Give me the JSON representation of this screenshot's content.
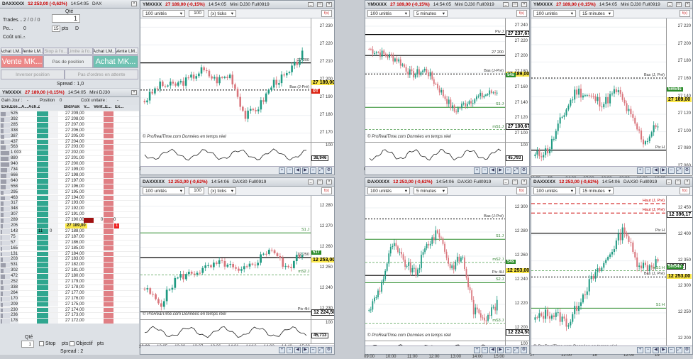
{
  "top_panel": {
    "title": {
      "ticker": "DAXXXXX",
      "price": "12 253,00 (-0,62%)",
      "time": "14:54:05",
      "name": "DAX"
    },
    "qty_label": "Qté",
    "qty_value": "1",
    "trades_label": "Trades...",
    "trades_value": "2 / 0 / 0",
    "po_label": "Po...",
    "po_value": "0",
    "d_label": "D",
    "pts_value": "15",
    "pts_label": "pts",
    "cout_label": "Coût uni...",
    "cout_value": "-",
    "buttons": [
      "Achat LM...",
      "Vente LM...",
      "Stop à l'o...",
      "Limite à l'o...",
      "Achat LM...",
      "Vente LM..."
    ],
    "vente_mkt": "Vente MK...",
    "achat_mkt": "Achat MK...",
    "pas_de_position": "Pas de position",
    "inverser": "Inverser position",
    "pas_ordres": "Pas d'ordres en attente",
    "spread": "Spread : 1,0"
  },
  "ladder_panel": {
    "title": {
      "ticker": "YMXXXX",
      "price": "27 189,00 (-0,15%)",
      "time": "14:54:05",
      "name": "Mini DJ30"
    },
    "gain_label": "Gain Jour :",
    "gain_value": "-",
    "position_label": "Position",
    "position_value": "0",
    "cout_label": "Coût unitaire :",
    "cout_value": "-",
    "headers": [
      "Exé...",
      "Exé...",
      "A...",
      "Ach...",
      "/",
      "Bid/Ask",
      "V...",
      "Vent...",
      "E...",
      "Ex..."
    ],
    "rows": [
      {
        "v": "525",
        "p": "27 209,00"
      },
      {
        "v": "392",
        "p": "27 208,00"
      },
      {
        "v": "285",
        "p": "27 207,00"
      },
      {
        "v": "338",
        "p": "27 206,00"
      },
      {
        "v": "387",
        "p": "27 205,00"
      },
      {
        "v": "437",
        "p": "27 204,00"
      },
      {
        "v": "563",
        "p": "27 203,00"
      },
      {
        "v": "1 003",
        "p": "27 202,00"
      },
      {
        "v": "880",
        "p": "27 201,00"
      },
      {
        "v": "940",
        "p": "27 200,00"
      },
      {
        "v": "734",
        "p": "27 199,00"
      },
      {
        "v": "666",
        "p": "27 198,00"
      },
      {
        "v": "640",
        "p": "27 197,00"
      },
      {
        "v": "558",
        "p": "27 196,00"
      },
      {
        "v": "295",
        "p": "27 195,00"
      },
      {
        "v": "463",
        "p": "27 194,00"
      },
      {
        "v": "317",
        "p": "27 193,00"
      },
      {
        "v": "348",
        "p": "27 192,00"
      },
      {
        "v": "307",
        "p": "27 191,00"
      },
      {
        "v": "289",
        "p": "27 190,00",
        "s": "0",
        "x": "0"
      },
      {
        "v": "205",
        "p": "27 189,00",
        "y": "1"
      },
      {
        "v": "143",
        "p": "27 188,00",
        "b": "11",
        "c": "0"
      },
      {
        "v": "75",
        "p": "27 187,00"
      },
      {
        "v": "57",
        "p": "27 186,00"
      },
      {
        "v": "165",
        "p": "27 185,00"
      },
      {
        "v": "131",
        "p": "27 184,00"
      },
      {
        "v": "203",
        "p": "27 183,00"
      },
      {
        "v": "531",
        "p": "27 182,00"
      },
      {
        "v": "302",
        "p": "27 181,00"
      },
      {
        "v": "472",
        "p": "27 180,00"
      },
      {
        "v": "252",
        "p": "27 179,00"
      },
      {
        "v": "338",
        "p": "27 178,00"
      },
      {
        "v": "264",
        "p": "27 177,00"
      },
      {
        "v": "170",
        "p": "27 176,00"
      },
      {
        "v": "209",
        "p": "27 175,00"
      },
      {
        "v": "230",
        "p": "27 174,00"
      },
      {
        "v": "236",
        "p": "27 173,00"
      },
      {
        "v": "178",
        "p": "27 172,00"
      }
    ],
    "qty_label": "Qté",
    "qty_value": "1",
    "stop_label": "Stop",
    "pts_label": "pts",
    "objectif_label": "Objectif",
    "pts2_label": "pts",
    "spread": "Spread : 2"
  },
  "charts": [
    {
      "id": "c1",
      "title": {
        "ticker": "YMXXXX",
        "price": "27 189,00 (-0,15%)",
        "time": "14:54:05",
        "name": "Mini DJ30 Full0919"
      },
      "units": "100 unités",
      "qty": "100",
      "period": "(x) ticks",
      "yticks": [
        "27 230",
        "27 220",
        "27 210",
        "27 200",
        "27 190",
        "27 180",
        "27 170"
      ],
      "levels": [
        {
          "label": "27 200",
          "style": "solid"
        },
        {
          "label": "Bas (J-Pré)",
          "style": "dash"
        }
      ],
      "price_box": "27 189,00",
      "red_box": "0T",
      "ind": {
        "top": "100",
        "val": "38,946"
      },
      "xticks": [
        "13:19",
        "13:25",
        "13:36",
        "13:48",
        "14:02",
        "14:13",
        "14:26",
        "14:36",
        "14:42",
        "14:48",
        "15:01",
        "15:13"
      ],
      "xbold": "14:02",
      "watermark": "© ProRealTime.com  Données en temps réel"
    },
    {
      "id": "c2",
      "title": {
        "ticker": "YMXXXX",
        "price": "27 189,00 (-0,15%)",
        "time": "14:54:05",
        "name": "Mini DJ30 Full0919"
      },
      "units": "100 unités",
      "period": "5 minutes",
      "yticks": [
        "27 240",
        "27 220",
        "27 200",
        "27 180",
        "27 160",
        "27 140",
        "27 120",
        "27 100"
      ],
      "levels": [
        {
          "label": "Piv J",
          "style": "solid"
        },
        {
          "label": "27 200",
          "style": "solid"
        },
        {
          "label": "Bas (J-Pré)",
          "style": "dash"
        },
        {
          "label": "S1 J",
          "style": "green"
        },
        {
          "label": "mS1 J",
          "style": "gdash"
        }
      ],
      "boxes": [
        "27 237,67",
        "27 189,00",
        "27 100,67"
      ],
      "green_box": "54s",
      "ind": {
        "top": "100",
        "val": "45,793"
      },
      "xticks": [
        "09:00",
        "10:00",
        "11:00",
        "12:00",
        "13:00",
        "14:00",
        "15:00"
      ],
      "watermark": "© ProRealTime.com  Données en temps réel"
    },
    {
      "id": "c3",
      "title": {
        "ticker": "YMXXXX",
        "price": "27 189,00 (-0,15%)",
        "time": "14:54:05",
        "name": "Mini DJ30 Full0919"
      },
      "units": "100 unités",
      "period": "15 minutes",
      "yticks": [
        "27 220",
        "27 200",
        "27 180",
        "27 160",
        "27 140",
        "27 120",
        "27 100",
        "27 080",
        "27 060"
      ],
      "levels": [
        {
          "label": "Bas (J, Pré)",
          "style": "dash"
        },
        {
          "label": "Piv H",
          "style": "solid"
        }
      ],
      "price_box": "27 189,00",
      "green_box": "5m54s",
      "xticks": [
        "22:00",
        "18",
        "04:00",
        "07:00",
        "10:00",
        "13:00",
        "16:00",
        "19:00"
      ],
      "xbold": "18",
      "watermark": "© ProRealTime.com  Données en temps réel"
    },
    {
      "id": "c4",
      "title": {
        "ticker": "DAXXXXX",
        "price": "12 253,00 (-0,62%)",
        "time": "14:54:06",
        "name": "DAX30 Full0919"
      },
      "units": "100 unités",
      "qty": "100",
      "period": "(x) ticks",
      "yticks": [
        "12 280",
        "12 270",
        "12 260",
        "12 250",
        "12 240",
        "12 230"
      ],
      "levels": [
        {
          "label": "S1 J",
          "style": "green"
        },
        {
          "label": "12 250",
          "style": "solid"
        },
        {
          "label": "mS2 J",
          "style": "gdash"
        },
        {
          "label": "Piv 4H",
          "style": "solid"
        }
      ],
      "price_box": "12 253,00",
      "green_box": "51T",
      "bottom_box": "12 224,50",
      "ind": {
        "top": "100",
        "val": "45,713"
      },
      "xticks": [
        "13:00",
        "13:05",
        "13:20",
        "13:27",
        "13:36",
        "14:01",
        "14:16",
        "14:32",
        "14:40",
        "15:00"
      ],
      "xbold": "13:00",
      "watermark": "© ProRealTime.com  Données en temps réel"
    },
    {
      "id": "c5",
      "title": {
        "ticker": "DAXXXXX",
        "price": "12 253,00 (-0,62%)",
        "time": "14:54:06",
        "name": "DAX30 Full0919"
      },
      "units": "100 unités",
      "period": "5 minutes",
      "yticks": [
        "12 300",
        "12 280",
        "12 260",
        "12 240",
        "12 220",
        "12 200"
      ],
      "levels": [
        {
          "label": "Bas (J-Pré)",
          "style": "dash"
        },
        {
          "label": "S1 J",
          "style": "green"
        },
        {
          "label": "mS2 J",
          "style": "gdash"
        },
        {
          "label": "Piv 4H",
          "style": "solid"
        },
        {
          "label": "S2 J",
          "style": "green"
        },
        {
          "label": "mS3 J",
          "style": "gdash"
        }
      ],
      "price_box": "12 253,00",
      "green_box": "54s",
      "bottom_box": "12 224,50",
      "ind": {
        "top": "100",
        "val": "46,105"
      },
      "xticks": [
        "09:00",
        "10:00",
        "11:00",
        "12:00",
        "13:00",
        "14:00",
        "15:00"
      ],
      "watermark": "© ProRealTime.com  Données en temps réel"
    },
    {
      "id": "c6",
      "title": {
        "ticker": "DAXXXXX",
        "price": "12 253,00 (-0,62%)",
        "time": "14:54:06",
        "name": "DAX30 Full0919"
      },
      "units": "100 unités",
      "period": "15 minutes",
      "yticks": [
        "12 450",
        "12 400",
        "12 350",
        "12 300",
        "12 250",
        "12 200"
      ],
      "levels": [
        {
          "label": "Haut (J, Pré)",
          "style": "rdash"
        },
        {
          "label": "Haut (J, Pré)",
          "style": "rdash"
        },
        {
          "label": "Piv H",
          "style": "solid"
        },
        {
          "label": "mS1 H",
          "style": "gdash"
        },
        {
          "label": "Bas (J, Pré)",
          "style": "dash"
        },
        {
          "label": "S1 H",
          "style": "green"
        }
      ],
      "boxes": [
        "12 396,17",
        "12 162"
      ],
      "price_box": "12 253,00",
      "green_box": "5m54s",
      "xticks": [
        "17",
        "12:00",
        "18",
        "12:00",
        "19"
      ],
      "watermark": "© ProRealTime.com  Données en temps réel"
    }
  ]
}
